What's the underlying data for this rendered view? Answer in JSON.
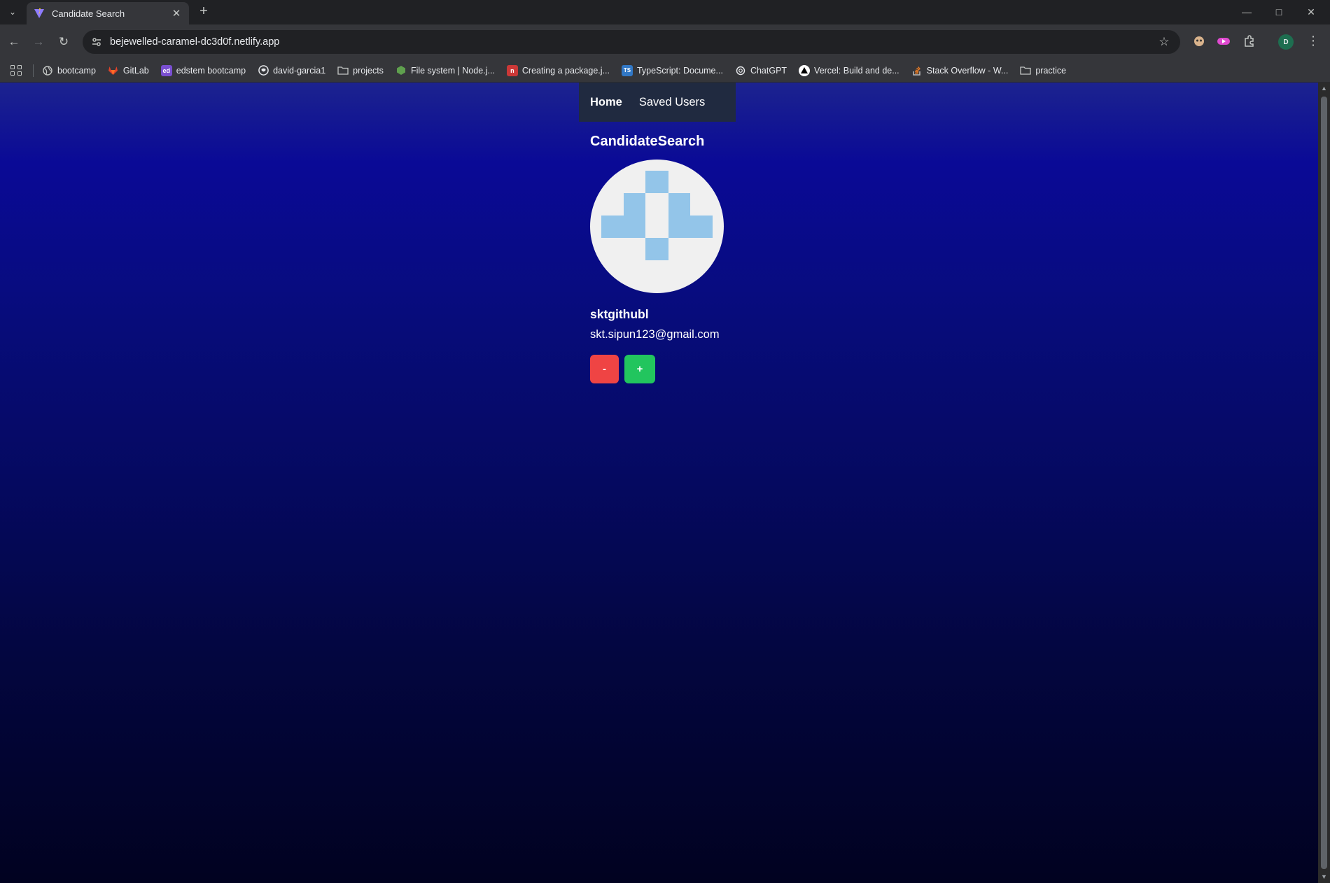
{
  "browser": {
    "tab_title": "Candidate Search",
    "url": "bejewelled-caramel-dc3d0f.netlify.app",
    "profile_initial": "D",
    "bookmarks": [
      {
        "label": "bootcamp",
        "icon": "globe-icon"
      },
      {
        "label": "GitLab",
        "icon": "gitlab-icon"
      },
      {
        "label": "edstem bootcamp",
        "icon": "edstem-icon"
      },
      {
        "label": "david-garcia1",
        "icon": "github-icon"
      },
      {
        "label": "projects",
        "icon": "folder-icon"
      },
      {
        "label": "File system | Node.j...",
        "icon": "nodejs-icon"
      },
      {
        "label": "Creating a package.j...",
        "icon": "npm-icon"
      },
      {
        "label": "TypeScript: Docume...",
        "icon": "typescript-icon"
      },
      {
        "label": "ChatGPT",
        "icon": "chatgpt-icon"
      },
      {
        "label": "Vercel: Build and de...",
        "icon": "vercel-icon"
      },
      {
        "label": "Stack Overflow - W...",
        "icon": "stackoverflow-icon"
      },
      {
        "label": "practice",
        "icon": "folder-icon"
      }
    ]
  },
  "nav": {
    "home": "Home",
    "saved_users": "Saved Users"
  },
  "page": {
    "title": "CandidateSearch"
  },
  "candidate": {
    "username": "sktgithubl",
    "email": "skt.sipun123@gmail.com",
    "avatar_color": "#93c5e9"
  },
  "actions": {
    "reject_label": "-",
    "accept_label": "+"
  },
  "colors": {
    "reject": "#ef4444",
    "accept": "#22c55e",
    "nav_bg": "#202a40"
  }
}
